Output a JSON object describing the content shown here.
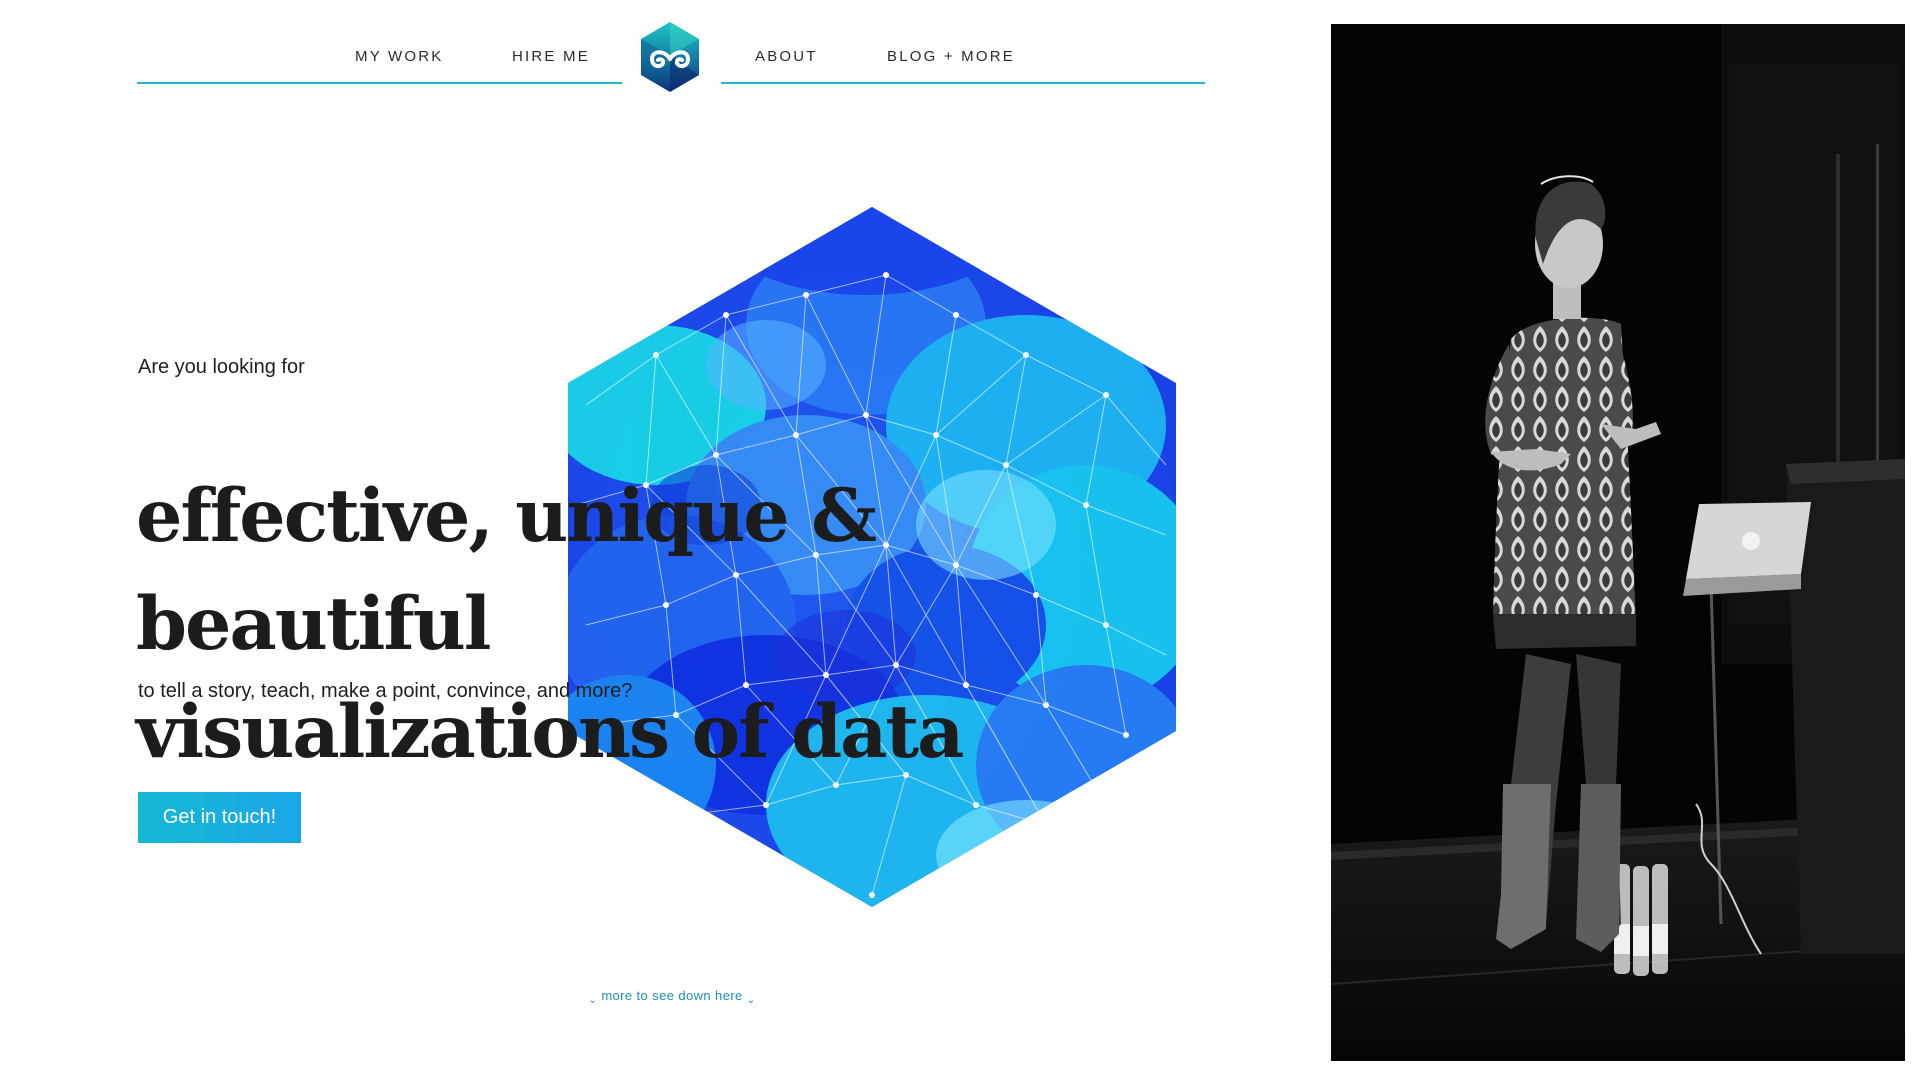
{
  "nav": {
    "items": [
      {
        "label": "MY WORK"
      },
      {
        "label": "HIRE ME"
      },
      {
        "label": "ABOUT"
      },
      {
        "label": "BLOG + MORE"
      }
    ],
    "logo_icon": "infinity-eyes-logo-icon",
    "line_color": "#1fb7cf"
  },
  "hero": {
    "intro": "Are you looking for",
    "headline_line1": "effective, unique & beautiful",
    "headline_line2": "visualizations of data",
    "sub": "to tell a story, teach, make a point, convince, and more?",
    "cta_label": "Get in touch!",
    "graphic_icon": "hexagon-data-network-graphic"
  },
  "footer": {
    "more_label": "more to see down here"
  },
  "photo": {
    "description_icon": "speaker-on-stage-photo"
  },
  "colors": {
    "accent": "#1fb7cf",
    "cta_start": "#15b8d3",
    "cta_end": "#1aa6e6",
    "link": "#1c8fb3",
    "hex_blue": "#1a3fe6",
    "hex_cyan": "#18d6f0"
  }
}
